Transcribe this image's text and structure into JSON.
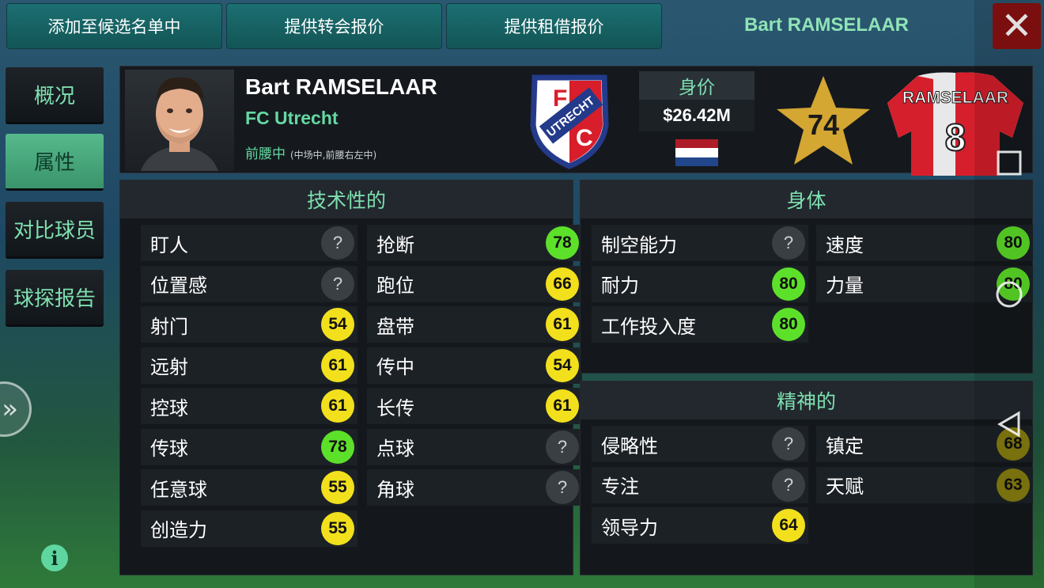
{
  "top_bar": {
    "shortlist_label": "添加至候选名单中",
    "transfer_label": "提供转会报价",
    "loan_label": "提供租借报价",
    "title": "Bart RAMSELAAR"
  },
  "sidebar": {
    "tabs": [
      {
        "label": "概况"
      },
      {
        "label": "属性"
      },
      {
        "label": "对比球员"
      },
      {
        "label": "球探报告"
      }
    ]
  },
  "player": {
    "name": "Bart RAMSELAAR",
    "club": "FC Utrecht",
    "position": "前腰中",
    "secondary_positions": "(中场中,前腰右左中)",
    "value_label": "身价",
    "value": "$26.42M",
    "rating": "74",
    "shirt_name": "RAMSELAAR",
    "shirt_number": "8",
    "crest_text_top": "F",
    "crest_text_mid": "UTRECHT",
    "crest_text_bottom": "C"
  },
  "colors": {
    "accent": "#64d9a2",
    "badge_yellow": "#f2e01d",
    "badge_green": "#5de02a",
    "flag": [
      "#ae1c28",
      "#ffffff",
      "#21468b"
    ]
  },
  "technical": {
    "title": "技术性的",
    "left": [
      {
        "name": "盯人",
        "value": "?"
      },
      {
        "name": "位置感",
        "value": "?"
      },
      {
        "name": "射门",
        "value": "54"
      },
      {
        "name": "远射",
        "value": "61"
      },
      {
        "name": "控球",
        "value": "61"
      },
      {
        "name": "传球",
        "value": "78"
      },
      {
        "name": "任意球",
        "value": "55"
      },
      {
        "name": "创造力",
        "value": "55"
      }
    ],
    "right": [
      {
        "name": "抢断",
        "value": "78"
      },
      {
        "name": "跑位",
        "value": "66"
      },
      {
        "name": "盘带",
        "value": "61"
      },
      {
        "name": "传中",
        "value": "54"
      },
      {
        "name": "长传",
        "value": "61"
      },
      {
        "name": "点球",
        "value": "?"
      },
      {
        "name": "角球",
        "value": "?"
      }
    ]
  },
  "physical": {
    "title": "身体",
    "left": [
      {
        "name": "制空能力",
        "value": "?"
      },
      {
        "name": "耐力",
        "value": "80"
      },
      {
        "name": "工作投入度",
        "value": "80"
      }
    ],
    "right": [
      {
        "name": "速度",
        "value": "80"
      },
      {
        "name": "力量",
        "value": "80"
      }
    ]
  },
  "mental": {
    "title": "精神的",
    "left": [
      {
        "name": "侵略性",
        "value": "?"
      },
      {
        "name": "专注",
        "value": "?"
      },
      {
        "name": "领导力",
        "value": "64"
      }
    ],
    "right": [
      {
        "name": "镇定",
        "value": "68"
      },
      {
        "name": "天赋",
        "value": "63"
      }
    ]
  },
  "icons": {
    "info": "i",
    "close": "✕",
    "expand": "»"
  }
}
